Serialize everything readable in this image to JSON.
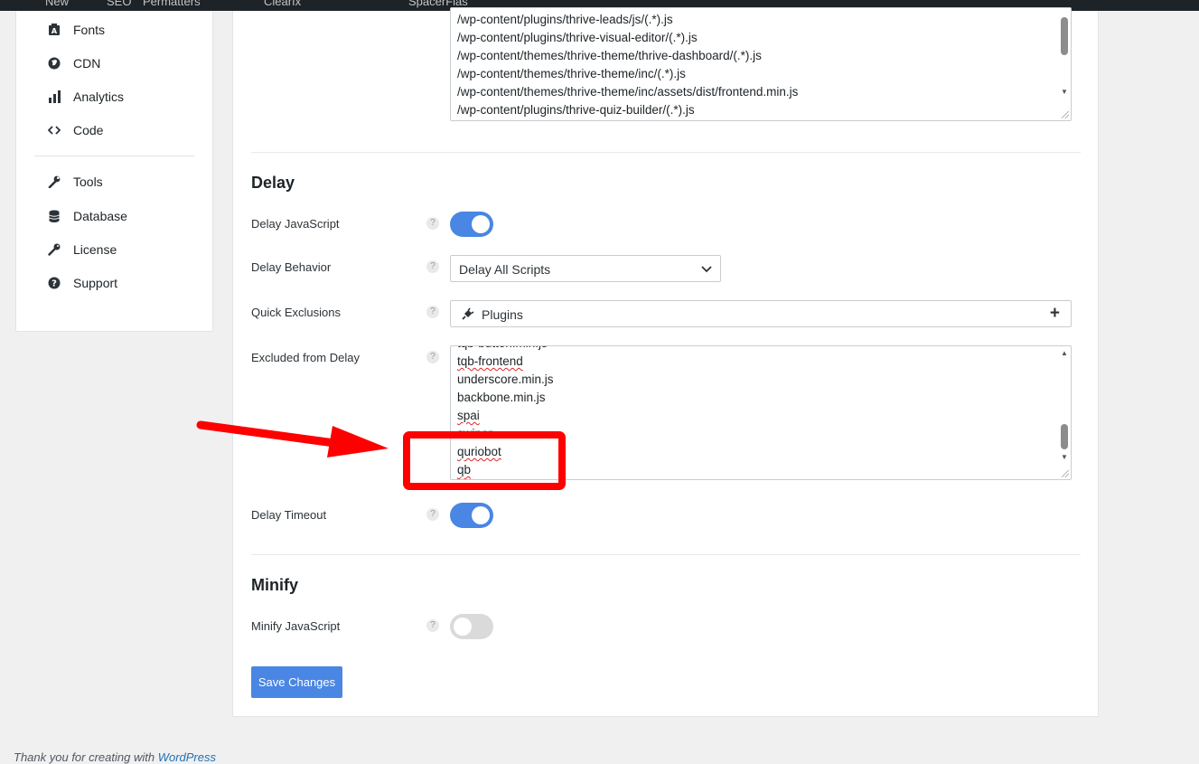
{
  "admin_bar": {
    "items": [
      "New",
      "SEO",
      "Permatters",
      "Clearfx",
      "SpacerFlas"
    ]
  },
  "sidebar": {
    "items": [
      {
        "label": "Fonts",
        "icon": "font-icon"
      },
      {
        "label": "CDN",
        "icon": "globe-icon"
      },
      {
        "label": "Analytics",
        "icon": "bar-chart-icon"
      },
      {
        "label": "Code",
        "icon": "code-icon"
      },
      {
        "label": "Tools",
        "icon": "wrench-icon"
      },
      {
        "label": "Database",
        "icon": "database-icon"
      },
      {
        "label": "License",
        "icon": "key-icon"
      },
      {
        "label": "Support",
        "icon": "question-circle-icon"
      }
    ]
  },
  "excluded_top_textarea": {
    "lines": [
      "/wp-content/plugins/thrive-leads/js/(.*).js",
      "/wp-content/plugins/thrive-visual-editor/(.*).js",
      "/wp-content/themes/thrive-theme/thrive-dashboard/(.*).js",
      "/wp-content/themes/thrive-theme/inc/(.*).js",
      "/wp-content/themes/thrive-theme/inc/assets/dist/frontend.min.js",
      "/wp-content/plugins/thrive-quiz-builder/(.*).js"
    ]
  },
  "delay": {
    "title": "Delay",
    "delay_js": {
      "label": "Delay JavaScript",
      "help": "?",
      "enabled": true
    },
    "behavior": {
      "label": "Delay Behavior",
      "help": "?",
      "value": "Delay All Scripts"
    },
    "quick_exclusions": {
      "label": "Quick Exclusions",
      "help": "?",
      "value": "Plugins",
      "icon": "plug-icon",
      "add": "+"
    },
    "excluded": {
      "label": "Excluded from Delay",
      "help": "?",
      "lines": [
        "tqb-frontend",
        "underscore.min.js",
        "backbone.min.js",
        "spai",
        "quriobot",
        "qb"
      ]
    },
    "timeout": {
      "label": "Delay Timeout",
      "help": "?",
      "enabled": true
    }
  },
  "minify": {
    "title": "Minify",
    "minify_js": {
      "label": "Minify JavaScript",
      "help": "?",
      "enabled": false
    }
  },
  "save_label": "Save Changes",
  "footer": {
    "text": "Thank you for creating with ",
    "link": "WordPress"
  },
  "colors": {
    "accent": "#4a86e3",
    "annotation": "#ff0000",
    "admin_bar": "#1d2327"
  }
}
